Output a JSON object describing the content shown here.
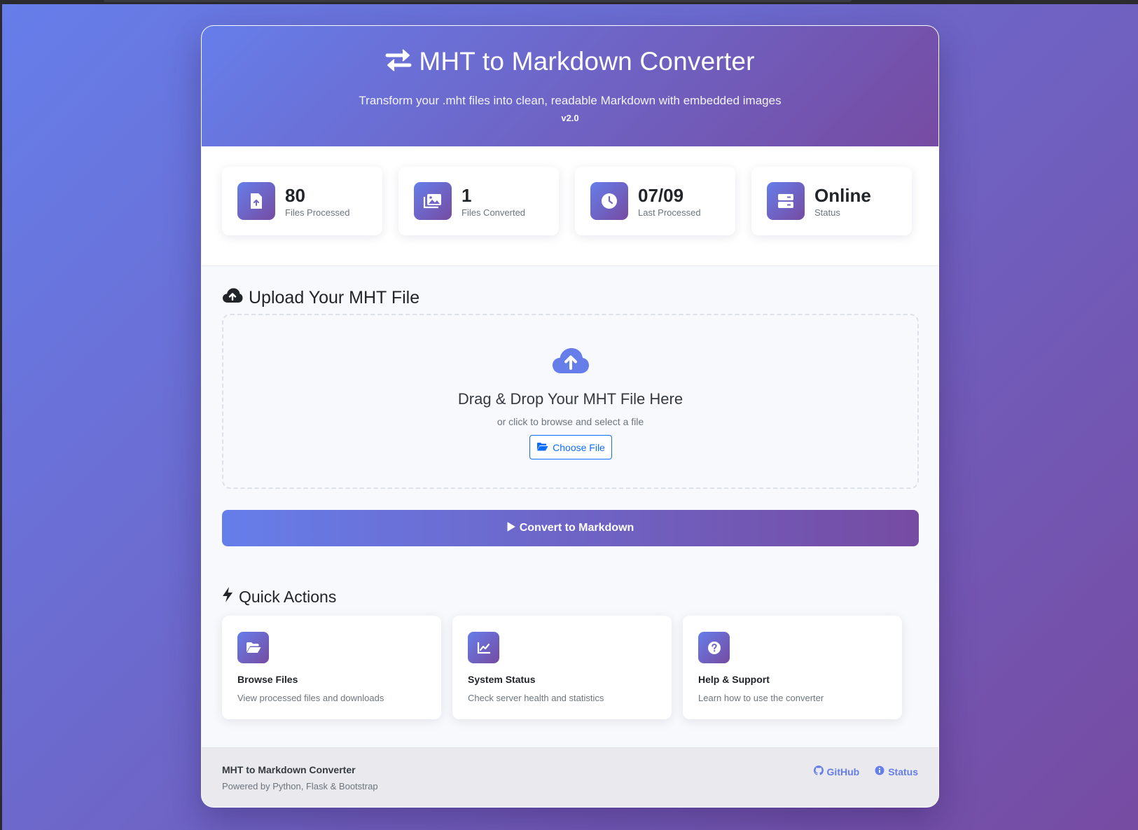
{
  "header": {
    "title": "MHT to Markdown Converter",
    "subtitle": "Transform your .mht files into clean, readable Markdown with embedded images",
    "version": "v2.0"
  },
  "stats": [
    {
      "value": "80",
      "label": "Files Processed",
      "icon": "file-upload-icon"
    },
    {
      "value": "1",
      "label": "Files Converted",
      "icon": "images-icon"
    },
    {
      "value": "07/09",
      "label": "Last Processed",
      "icon": "clock-icon"
    },
    {
      "value": "Online",
      "label": "Status",
      "icon": "server-icon"
    }
  ],
  "upload": {
    "section_title": "Upload Your MHT File",
    "drop_title": "Drag & Drop Your MHT File Here",
    "drop_subtitle": "or click to browse and select a file",
    "choose_label": "Choose File"
  },
  "convert_label": "Convert to Markdown",
  "quick_actions": {
    "title": "Quick Actions",
    "items": [
      {
        "title": "Browse Files",
        "desc": "View processed files and downloads",
        "icon": "folder-open-icon"
      },
      {
        "title": "System Status",
        "desc": "Check server health and statistics",
        "icon": "chart-line-icon"
      },
      {
        "title": "Help & Support",
        "desc": "Learn how to use the converter",
        "icon": "question-icon"
      }
    ]
  },
  "footer": {
    "title": "MHT to Markdown Converter",
    "subtitle": "Powered by Python, Flask & Bootstrap",
    "github_label": "GitHub",
    "status_label": "Status"
  },
  "colors": {
    "gradient_start": "#667eea",
    "gradient_end": "#764ba2",
    "link_blue": "#0d6efd"
  }
}
